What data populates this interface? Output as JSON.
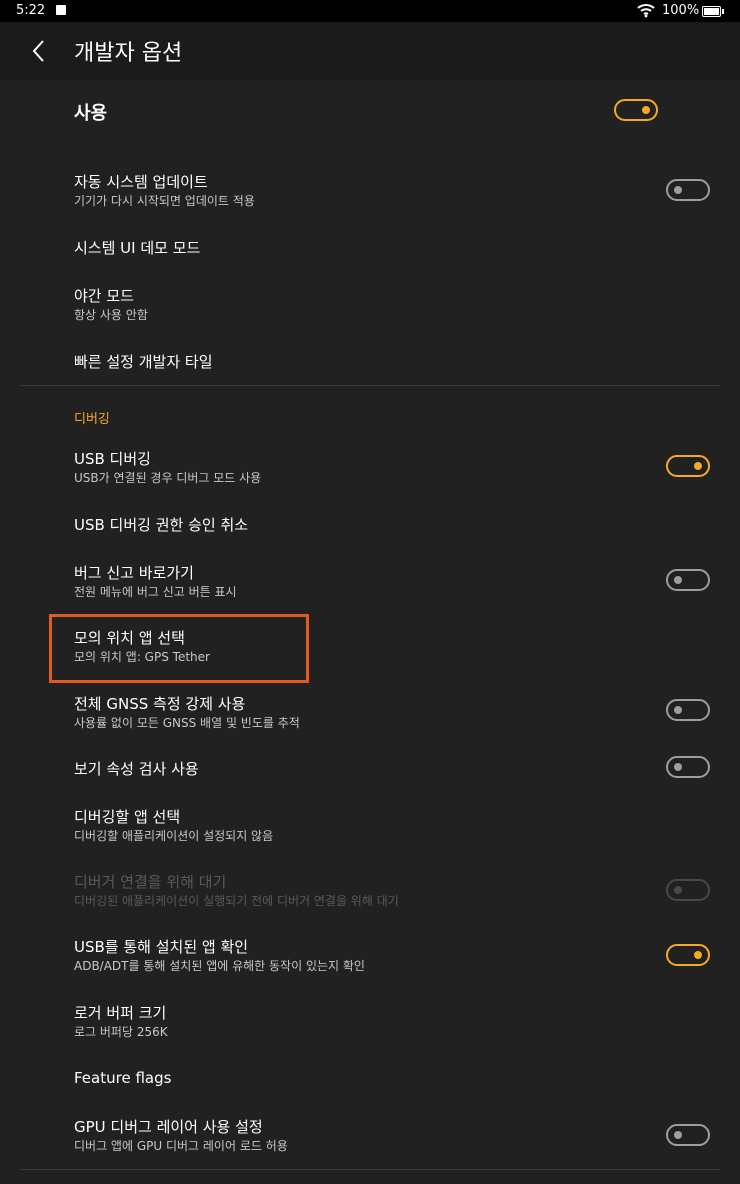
{
  "status_bar": {
    "time": "5:22",
    "battery": "100%"
  },
  "app_bar": {
    "title": "개발자 옵션"
  },
  "master": {
    "label": "사용",
    "on": true
  },
  "section_debug": "디버깅",
  "settings": [
    {
      "title": "자동 시스템 업데이트",
      "subtitle": "기기가 다시 시작되면 업데이트 적용",
      "toggle": "off"
    },
    {
      "title": "시스템 UI 데모 모드",
      "subtitle": ""
    },
    {
      "title": "야간 모드",
      "subtitle": "항상 사용 안함"
    },
    {
      "title": "빠른 설정 개발자 타일",
      "subtitle": ""
    },
    {
      "title": "USB 디버깅",
      "subtitle": "USB가 연결된 경우 디버그 모드 사용",
      "toggle": "on"
    },
    {
      "title": "USB 디버깅 권한 승인 취소",
      "subtitle": ""
    },
    {
      "title": "버그 신고 바로가기",
      "subtitle": "전원 메뉴에 버그 신고 버튼 표시",
      "toggle": "off"
    },
    {
      "title": "모의 위치 앱 선택",
      "subtitle": "모의 위치 앱: GPS Tether"
    },
    {
      "title": "전체 GNSS 측정 강제 사용",
      "subtitle": "사용률 없이 모든 GNSS 배열 및 빈도를 추적",
      "toggle": "off"
    },
    {
      "title": "보기 속성 검사 사용",
      "subtitle": "",
      "toggle": "off"
    },
    {
      "title": "디버깅할 앱 선택",
      "subtitle": "디버깅할 애플리케이션이 설정되지 않음"
    },
    {
      "title": "디버거 연결을 위해 대기",
      "subtitle": "디버깅된 애플리케이션이 실행되기 전에 디버거 연결을 위해 대기",
      "toggle": "disabled"
    },
    {
      "title": "USB를 통해 설치된 앱 확인",
      "subtitle": "ADB/ADT를 통해 설치된 앱에 유해한 동작이 있는지 확인",
      "toggle": "on"
    },
    {
      "title": "로거 버퍼 크기",
      "subtitle": "로그 버퍼당 256K"
    },
    {
      "title": "Feature flags",
      "subtitle": ""
    },
    {
      "title": "GPU 디버그 레이어 사용 설정",
      "subtitle": "디버그 앱에 GPU 디버그 레이어 로드 허용",
      "toggle": "off"
    }
  ],
  "colors": {
    "accent": "#f7a825",
    "highlight": "#e35b1a",
    "background": "#212121"
  },
  "icons": {
    "back": "back-arrow-icon",
    "wifi": "wifi-icon",
    "battery": "battery-icon",
    "notification": "image-notification-icon"
  }
}
